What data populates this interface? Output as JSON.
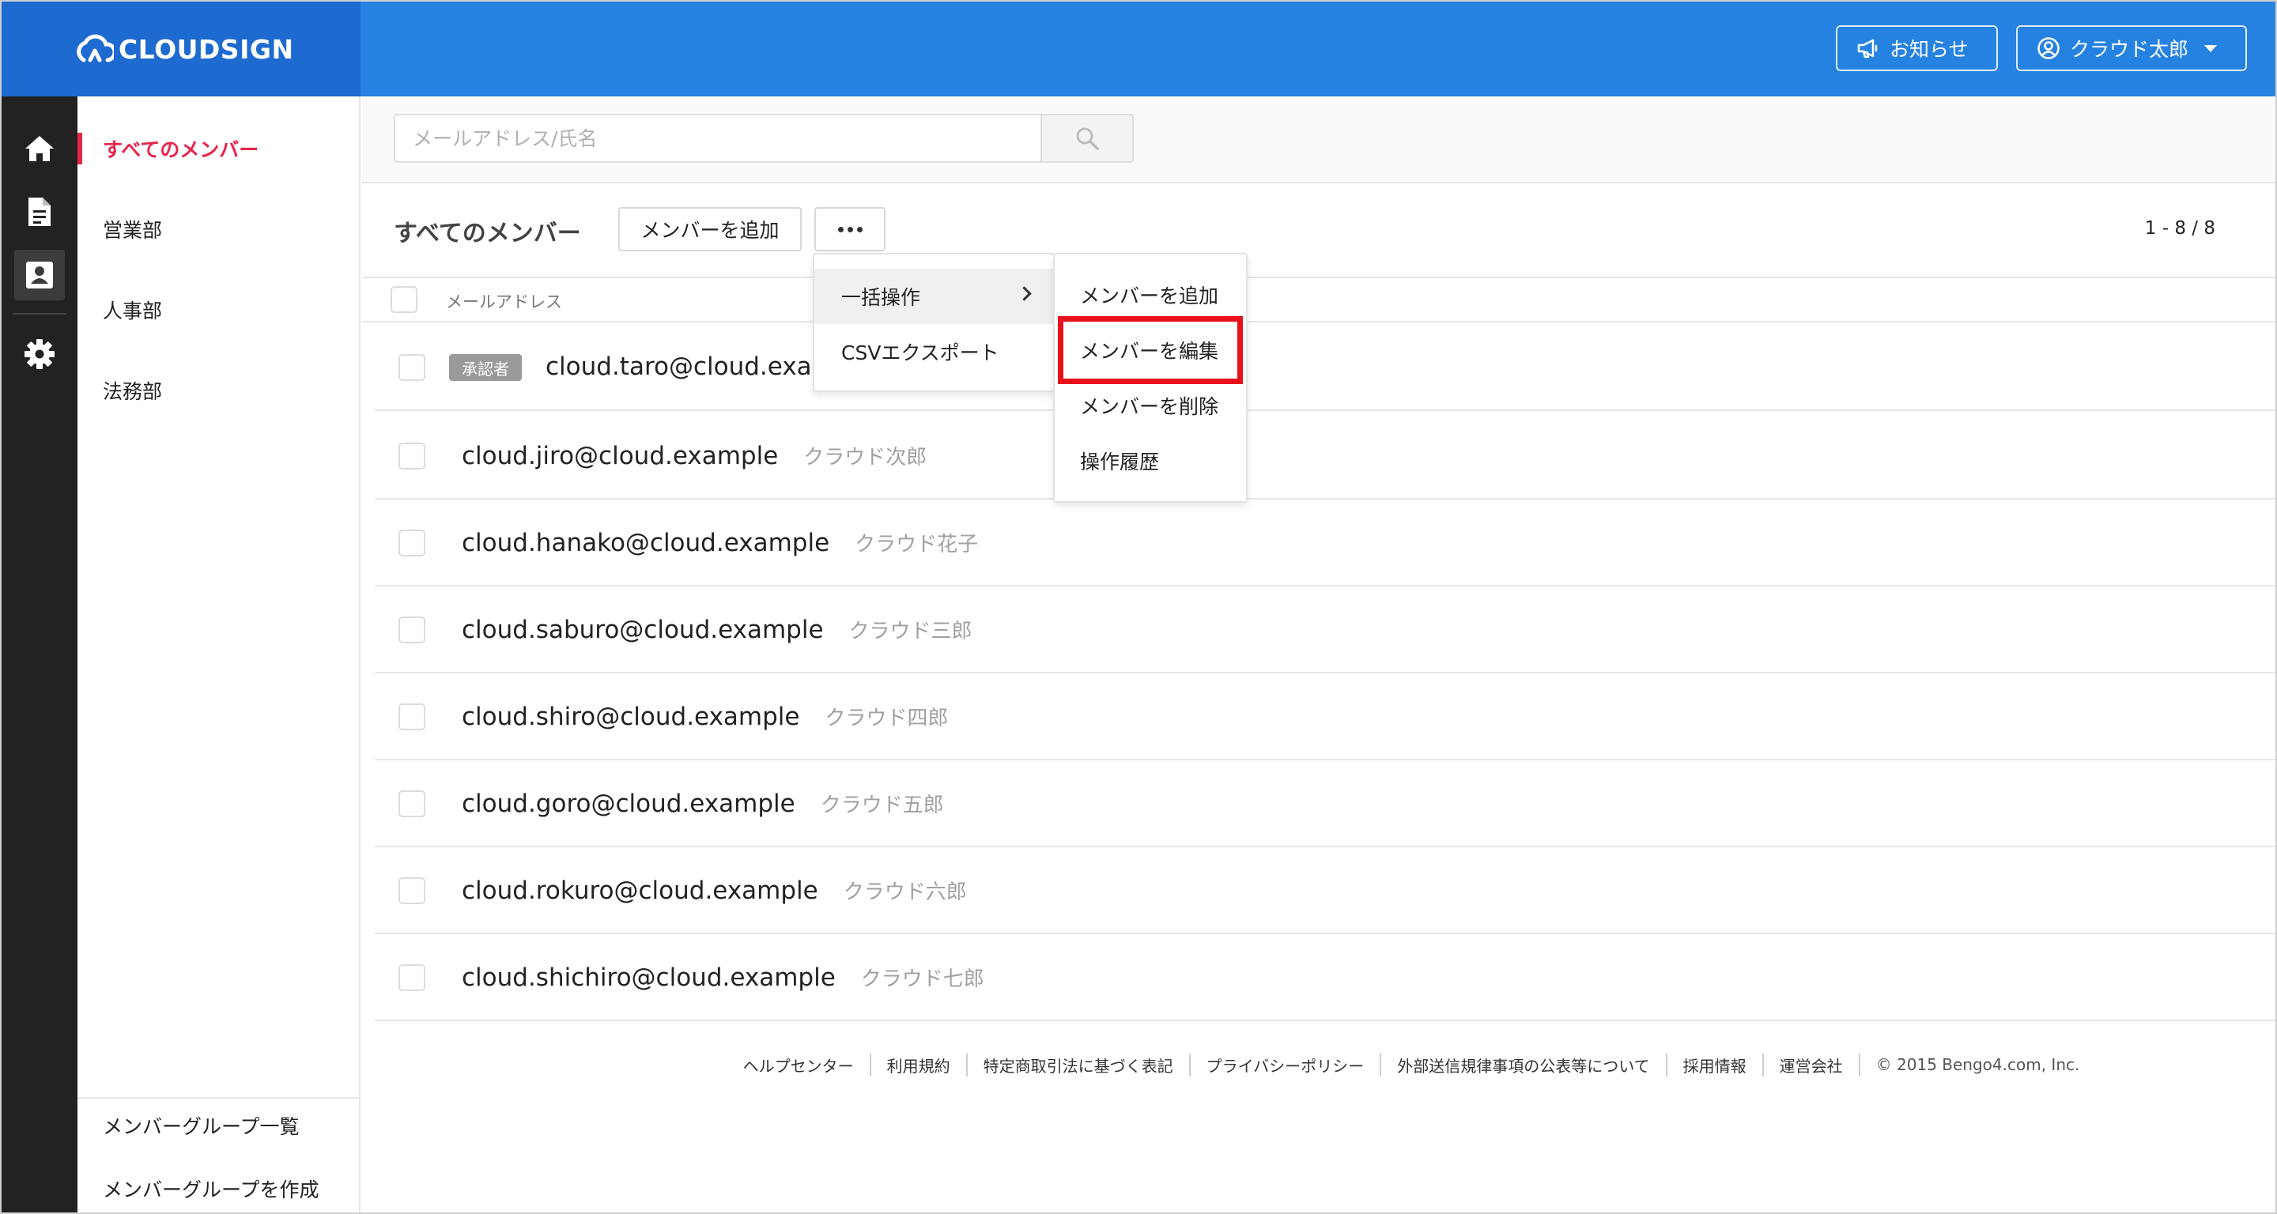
{
  "header": {
    "logo_text": "CLOUDSIGN",
    "notice_label": "お知らせ",
    "user_label": "クラウド太郎",
    "colors": {
      "header": "#2682e0",
      "logo_bg": "#1d6ad0",
      "accent": "#e6264c",
      "highlight": "#e8101a"
    }
  },
  "rail": {
    "items": [
      {
        "icon": "home-icon"
      },
      {
        "icon": "document-icon"
      },
      {
        "icon": "contacts-icon",
        "active": true
      },
      {
        "icon": "gear-icon"
      }
    ]
  },
  "sidebar": {
    "groups": [
      {
        "label": "すべてのメンバー",
        "active": true
      },
      {
        "label": "営業部"
      },
      {
        "label": "人事部"
      },
      {
        "label": "法務部"
      }
    ],
    "bottom": [
      {
        "label": "メンバーグループ一覧"
      },
      {
        "label": "メンバーグループを作成"
      }
    ]
  },
  "search": {
    "placeholder": "メールアドレス/氏名",
    "value": ""
  },
  "toolbar": {
    "title": "すべてのメンバー",
    "add_label": "メンバーを追加",
    "pager": "1 - 8 / 8"
  },
  "table": {
    "header_email": "メールアドレス",
    "rows": [
      {
        "email": "cloud.taro@cloud.examp",
        "name": "",
        "badge": "承認者"
      },
      {
        "email": "cloud.jiro@cloud.example",
        "name": "クラウド次郎"
      },
      {
        "email": "cloud.hanako@cloud.example",
        "name": "クラウド花子"
      },
      {
        "email": "cloud.saburo@cloud.example",
        "name": "クラウド三郎"
      },
      {
        "email": "cloud.shiro@cloud.example",
        "name": "クラウド四郎"
      },
      {
        "email": "cloud.goro@cloud.example",
        "name": "クラウド五郎"
      },
      {
        "email": "cloud.rokuro@cloud.example",
        "name": "クラウド六郎"
      },
      {
        "email": "cloud.shichiro@cloud.example",
        "name": "クラウド七郎"
      }
    ]
  },
  "menu_primary": [
    {
      "label": "一括操作",
      "has_submenu": true,
      "hovered": true
    },
    {
      "label": "CSVエクスポート"
    }
  ],
  "menu_sub": [
    {
      "label": "メンバーを追加"
    },
    {
      "label": "メンバーを編集",
      "highlighted": true
    },
    {
      "label": "メンバーを削除"
    },
    {
      "label": "操作履歴"
    }
  ],
  "footer": {
    "links": [
      "ヘルプセンター",
      "利用規約",
      "特定商取引法に基づく表記",
      "プライバシーポリシー",
      "外部送信規律事項の公表等について",
      "採用情報",
      "運営会社"
    ],
    "copyright": "© 2015 Bengo4.com, Inc."
  }
}
